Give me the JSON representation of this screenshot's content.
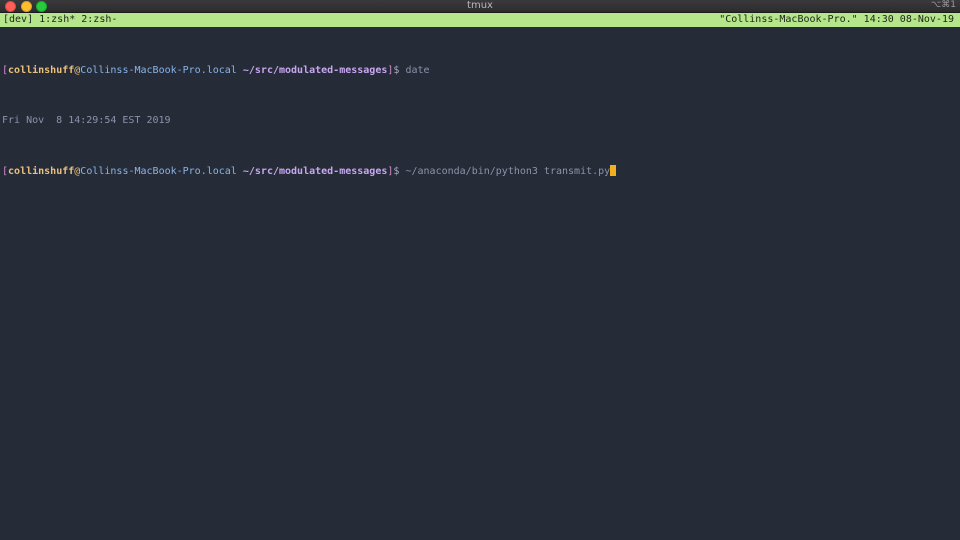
{
  "window": {
    "title": "tmux",
    "shortcut": "⌥⌘1"
  },
  "tmux_status": {
    "left": "[dev] 1:zsh* 2:zsh-",
    "right": "\"Collinss-MacBook-Pro.\" 14:30 08-Nov-19"
  },
  "terminal": {
    "prompt": {
      "open_bracket": "[",
      "user": "collinshuff",
      "at": "@",
      "host": "Collinss-MacBook-Pro.local",
      "path": "~/src/modulated-messages",
      "close_bracket": "]",
      "symbol": "$"
    },
    "lines": [
      {
        "command": "date"
      },
      {
        "output": "Fri Nov  8 14:29:54 EST 2019"
      },
      {
        "command": "~/anaconda/bin/python3 transmit.py"
      }
    ]
  },
  "colors": {
    "background": "#262b38",
    "status_bar": "#b6e68c",
    "cursor": "#f2b01e"
  }
}
